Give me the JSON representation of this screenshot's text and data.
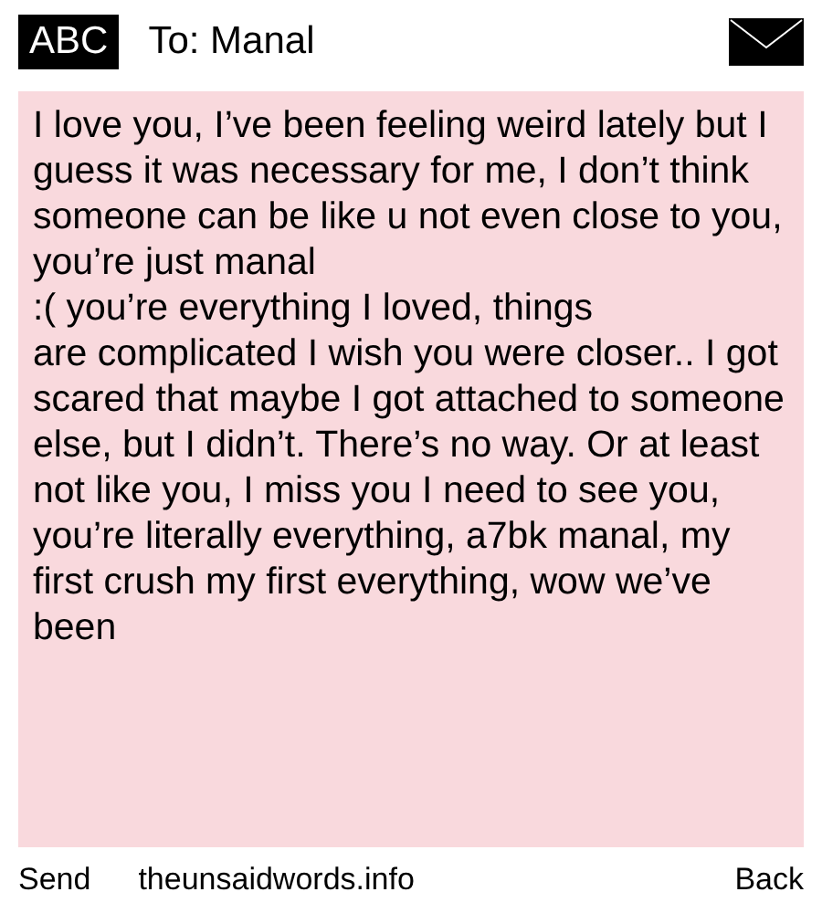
{
  "header": {
    "badge": "ABC",
    "recipient": "To: Manal"
  },
  "message": {
    "paragraphs": [
      "I love you, I’ve been feeling weird lately but I guess it was necessary for me, I don’t think someone can be like u not even close to you, you’re just manal",
      ":( you’re everything I loved, things",
      "are complicated I wish you were closer.. I got scared that maybe I got attached to someone else, but I didn’t. There’s no way. Or at least not like you, I miss you I need to see you, you’re literally everything, a7bk manal, my first crush my first everything, wow we’ve been"
    ]
  },
  "softkeys": {
    "left": "Send",
    "center": "theunsaidwords.info",
    "right": "Back"
  }
}
